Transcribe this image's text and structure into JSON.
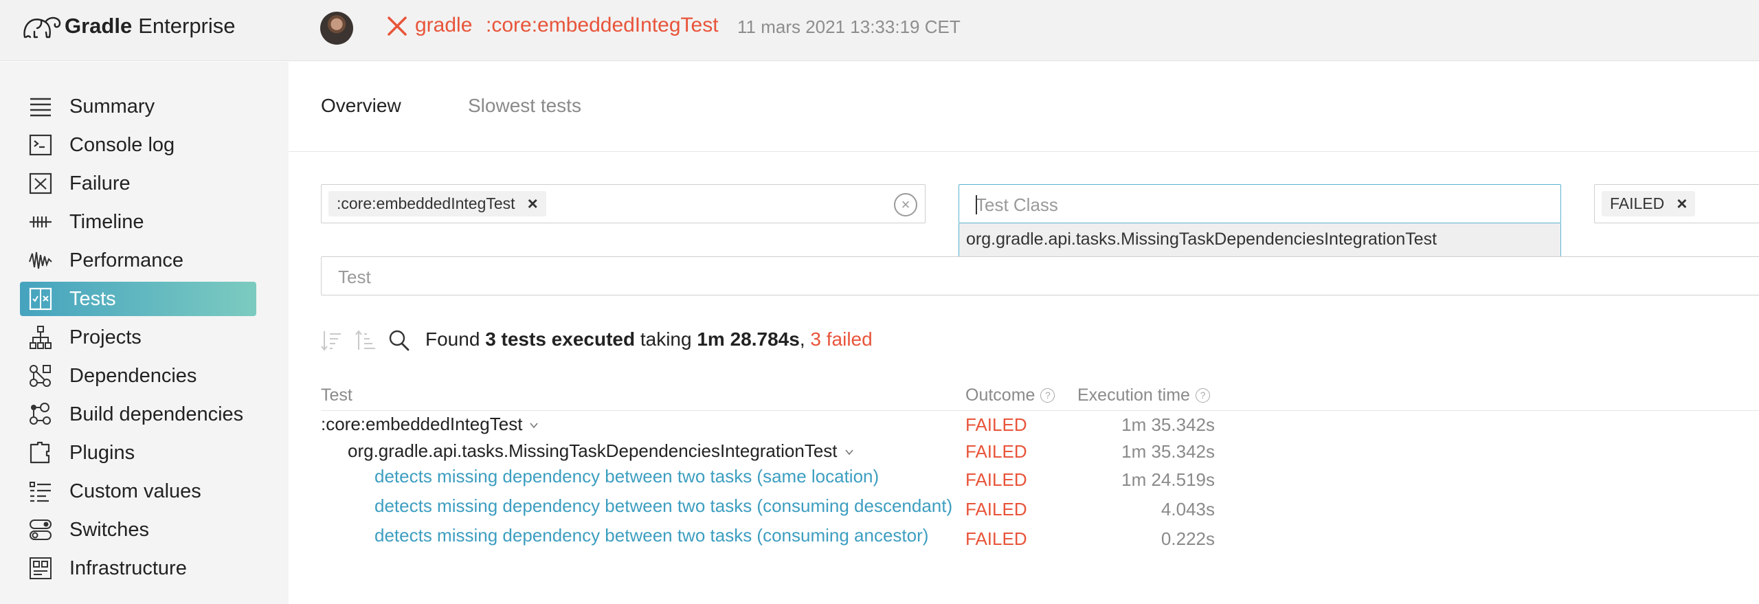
{
  "header": {
    "brand": "Gradle",
    "product": "Enterprise",
    "project": "gradle",
    "task": ":core:embeddedIntegTest",
    "timestamp": "11 mars 2021 13:33:19 CET",
    "status_color": "#e8543a"
  },
  "sidebar": {
    "items": [
      {
        "label": "Summary",
        "icon": "summary-icon"
      },
      {
        "label": "Console log",
        "icon": "console-icon"
      },
      {
        "label": "Failure",
        "icon": "failure-icon"
      },
      {
        "label": "Timeline",
        "icon": "timeline-icon"
      },
      {
        "label": "Performance",
        "icon": "performance-icon"
      },
      {
        "label": "Tests",
        "icon": "tests-icon",
        "active": true
      },
      {
        "label": "Projects",
        "icon": "projects-icon"
      },
      {
        "label": "Dependencies",
        "icon": "dependencies-icon"
      },
      {
        "label": "Build dependencies",
        "icon": "build-dependencies-icon"
      },
      {
        "label": "Plugins",
        "icon": "plugins-icon"
      },
      {
        "label": "Custom values",
        "icon": "custom-values-icon"
      },
      {
        "label": "Switches",
        "icon": "switches-icon"
      },
      {
        "label": "Infrastructure",
        "icon": "infrastructure-icon"
      }
    ]
  },
  "tabs": {
    "overview": "Overview",
    "slowest": "Slowest tests"
  },
  "filters": {
    "task_chip": ":core:embeddedIntegTest",
    "test_class_placeholder": "Test Class",
    "test_class_suggestion": "org.gradle.api.tasks.MissingTaskDependenciesIntegrationTest",
    "outcome_chip": "FAILED",
    "test_placeholder": "Test",
    "chip_remove": "×",
    "clear": "×"
  },
  "results": {
    "prefix": "Found",
    "count": "3 tests executed",
    "middle": "taking",
    "duration": "1m 28.784s",
    "separator": ",",
    "failed": "3 failed"
  },
  "table": {
    "headers": {
      "test": "Test",
      "outcome": "Outcome",
      "execution_time": "Execution time",
      "help": "?"
    },
    "rows": [
      {
        "name": ":core:embeddedIntegTest",
        "outcome": "FAILED",
        "time": "1m 35.342s"
      },
      {
        "name": "org.gradle.api.tasks.MissingTaskDependenciesIntegrationTest",
        "outcome": "FAILED",
        "time": "1m 35.342s"
      },
      {
        "name": "detects missing dependency between two tasks (same location)",
        "outcome": "FAILED",
        "time": "1m 24.519s"
      },
      {
        "name": "detects missing dependency between two tasks (consuming descendant)",
        "outcome": "FAILED",
        "time": "4.043s"
      },
      {
        "name": "detects missing dependency between two tasks (consuming ancestor)",
        "outcome": "FAILED",
        "time": "0.222s"
      }
    ]
  },
  "colors": {
    "accent": "#45a3bf",
    "link": "#3d9ec0",
    "failed": "#e8543a"
  }
}
